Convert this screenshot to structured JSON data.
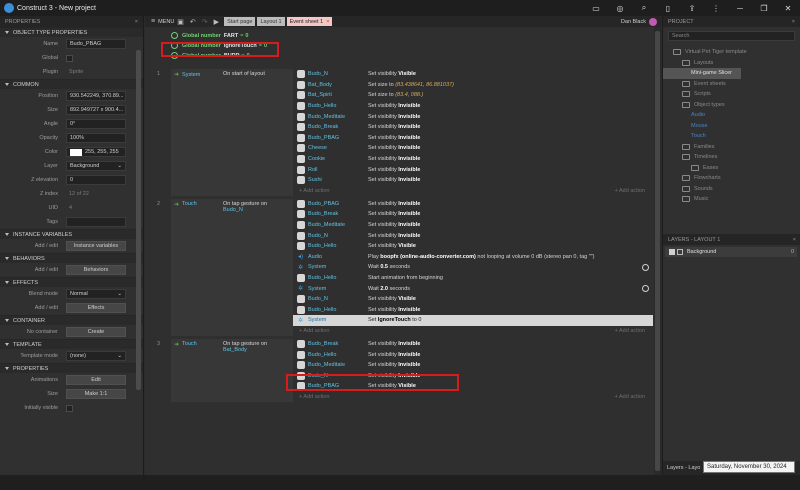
{
  "window": {
    "title": "Construct 3 - New project"
  },
  "left_panel": {
    "header": "PROPERTIES",
    "sections": [
      {
        "title": "OBJECT TYPE PROPERTIES",
        "rows": [
          {
            "label": "Name",
            "value": "Budo_PBAG",
            "kind": "input"
          },
          {
            "label": "Global",
            "value": "",
            "kind": "check"
          },
          {
            "label": "Plugin",
            "value": "Sprite",
            "kind": "plain"
          }
        ]
      },
      {
        "title": "COMMON",
        "rows": [
          {
            "label": "Position",
            "value": "930.542249, 370.89...",
            "kind": "input"
          },
          {
            "label": "Size",
            "value": "892.949727 x 900.4...",
            "kind": "input"
          },
          {
            "label": "Angle",
            "value": "0°",
            "kind": "input"
          },
          {
            "label": "Opacity",
            "value": "100%",
            "kind": "input"
          },
          {
            "label": "Color",
            "value": "255, 255, 255",
            "kind": "color"
          },
          {
            "label": "Layer",
            "value": "Background",
            "kind": "select"
          },
          {
            "label": "Z elevation",
            "value": "0",
            "kind": "input"
          },
          {
            "label": "Z index",
            "value": "12 of 22",
            "kind": "plain"
          },
          {
            "label": "UID",
            "value": "4",
            "kind": "plain"
          },
          {
            "label": "Tags",
            "value": "",
            "kind": "input"
          }
        ]
      },
      {
        "title": "INSTANCE VARIABLES",
        "rows": [
          {
            "label": "Add / edit",
            "value": "Instance variables",
            "kind": "button"
          }
        ]
      },
      {
        "title": "BEHAVIORS",
        "rows": [
          {
            "label": "Add / edit",
            "value": "Behaviors",
            "kind": "button"
          }
        ]
      },
      {
        "title": "EFFECTS",
        "rows": [
          {
            "label": "Blend mode",
            "value": "Normal",
            "kind": "select"
          },
          {
            "label": "Add / edit",
            "value": "Effects",
            "kind": "button"
          }
        ]
      },
      {
        "title": "CONTAINER",
        "rows": [
          {
            "label": "No container",
            "value": "Create",
            "kind": "button"
          }
        ]
      },
      {
        "title": "TEMPLATE",
        "rows": [
          {
            "label": "Template mode",
            "value": "(none)",
            "kind": "select"
          }
        ]
      },
      {
        "title": "PROPERTIES",
        "rows": [
          {
            "label": "Animations",
            "value": "Edit",
            "kind": "button"
          },
          {
            "label": "Size",
            "value": "Make 1:1",
            "kind": "button"
          },
          {
            "label": "Initially visible",
            "value": "",
            "kind": "check"
          }
        ]
      }
    ]
  },
  "menubar": {
    "menu_label": "MENU",
    "tabs": [
      "Start page",
      "Layout 1",
      "Event sheet 1"
    ],
    "tab_close": "×",
    "user": "Dan Black"
  },
  "event_sheet": {
    "globals": [
      {
        "keyword": "Global number",
        "name": "FART",
        "value": "0"
      },
      {
        "keyword": "Global number",
        "name": "IgnoreTouch",
        "value": "0"
      },
      {
        "keyword": "Global number",
        "name": "BURP",
        "value": "0"
      }
    ],
    "eq_sign": "=",
    "add_action": "+ Add action",
    "events": [
      {
        "number": "1",
        "cond_object": "System",
        "cond_text": "On start of layout",
        "actions": [
          {
            "object": "Budo_N",
            "pre": "Set visibility ",
            "bold": "Visible",
            "post": "",
            "icon": "sprite"
          },
          {
            "object": "Bat_Body",
            "pre": "Set size to ",
            "bold": "",
            "post": "(83.438641, 86.881037)",
            "icon": "sprite"
          },
          {
            "object": "Bat_Spirit",
            "pre": "Set size to ",
            "bold": "",
            "post": "(83.4, 088.)",
            "icon": "sprite"
          },
          {
            "object": "Budo_Hello",
            "pre": "Set visibility ",
            "bold": "Invisible",
            "post": "",
            "icon": "sprite"
          },
          {
            "object": "Budo_Meditate",
            "pre": "Set visibility ",
            "bold": "Invisible",
            "post": "",
            "icon": "sprite"
          },
          {
            "object": "Budo_Break",
            "pre": "Set visibility ",
            "bold": "Invisible",
            "post": "",
            "icon": "sprite"
          },
          {
            "object": "Budo_PBAG",
            "pre": "Set visibility ",
            "bold": "Invisible",
            "post": "",
            "icon": "sprite"
          },
          {
            "object": "Cheese",
            "pre": "Set visibility ",
            "bold": "Invisible",
            "post": "",
            "icon": "sprite"
          },
          {
            "object": "Cookie",
            "pre": "Set visibility ",
            "bold": "Invisible",
            "post": "",
            "icon": "sprite"
          },
          {
            "object": "Roll",
            "pre": "Set visibility ",
            "bold": "Invisible",
            "post": "",
            "icon": "sprite"
          },
          {
            "object": "Sushi",
            "pre": "Set visibility ",
            "bold": "Invisible",
            "post": "",
            "icon": "sprite"
          }
        ]
      },
      {
        "number": "2",
        "cond_object": "Touch",
        "cond_text": "On tap gesture on",
        "cond_target": "Budo_N",
        "actions": [
          {
            "object": "Budo_PBAG",
            "pre": "Set visibility ",
            "bold": "Invisible",
            "post": "",
            "icon": "sprite"
          },
          {
            "object": "Budo_Break",
            "pre": "Set visibility ",
            "bold": "Invisible",
            "post": "",
            "icon": "sprite"
          },
          {
            "object": "Budo_Meditate",
            "pre": "Set visibility ",
            "bold": "Invisible",
            "post": "",
            "icon": "sprite"
          },
          {
            "object": "Budo_N",
            "pre": "Set visibility ",
            "bold": "Invisible",
            "post": "",
            "icon": "sprite"
          },
          {
            "object": "Budo_Hello",
            "pre": "Set visibility ",
            "bold": "Visible",
            "post": "",
            "icon": "sprite"
          },
          {
            "object": "Audio",
            "pre": "Play ",
            "bold": "boopfx (online-audio-converter.com)",
            "post": " not looping at volume 0 dB (stereo pan 0, tag \"\")",
            "icon": "audio"
          },
          {
            "object": "System",
            "pre": "Wait ",
            "bold": "0.5",
            "post": " seconds",
            "icon": "gear",
            "wait": true
          },
          {
            "object": "Budo_Hello",
            "pre": "Start animation from beginning",
            "bold": "",
            "post": "",
            "icon": "sprite"
          },
          {
            "object": "System",
            "pre": "Wait ",
            "bold": "2.0",
            "post": " seconds",
            "icon": "gear",
            "wait": true
          },
          {
            "object": "Budo_N",
            "pre": "Set visibility ",
            "bold": "Visible",
            "post": "",
            "icon": "sprite"
          },
          {
            "object": "Budo_Hello",
            "pre": "Set visibility ",
            "bold": "Invisible",
            "post": "",
            "icon": "sprite"
          },
          {
            "object": "System",
            "pre": "Set ",
            "bold": "IgnoreTouch",
            "post": " to 0",
            "icon": "gear",
            "selected": true
          }
        ]
      },
      {
        "number": "3",
        "cond_object": "Touch",
        "cond_text": "On tap gesture on",
        "cond_target": "Bat_Body",
        "actions": [
          {
            "object": "Budo_Break",
            "pre": "Set visibility ",
            "bold": "Invisible",
            "post": "",
            "icon": "sprite"
          },
          {
            "object": "Budo_Hello",
            "pre": "Set visibility ",
            "bold": "Invisible",
            "post": "",
            "icon": "sprite"
          },
          {
            "object": "Budo_Meditate",
            "pre": "Set visibility ",
            "bold": "Invisible",
            "post": "",
            "icon": "sprite"
          },
          {
            "object": "Budo_N",
            "pre": "Set visibility ",
            "bold": "Invisible",
            "post": "",
            "icon": "sprite"
          },
          {
            "object": "Budo_PBAG",
            "pre": "Set visibility ",
            "bold": "Visible",
            "post": "",
            "icon": "sprite"
          }
        ]
      }
    ]
  },
  "project_panel": {
    "header": "PROJECT",
    "search_placeholder": "Search",
    "tree": [
      {
        "label": "Virtual Pet Tiger template",
        "depth": 0,
        "folder": true
      },
      {
        "label": "Layouts",
        "depth": 1,
        "folder": true
      },
      {
        "label": "Mini-game Slicer",
        "depth": 2,
        "folder": false,
        "highlight": true
      },
      {
        "label": "Event sheets",
        "depth": 1,
        "folder": true
      },
      {
        "label": "Scripts",
        "depth": 1,
        "folder": true
      },
      {
        "label": "Object types",
        "depth": 1,
        "folder": true
      },
      {
        "label": "Audio",
        "depth": 2,
        "folder": false,
        "blue": true
      },
      {
        "label": "Mouse",
        "depth": 2,
        "folder": false,
        "blue": true
      },
      {
        "label": "Touch",
        "depth": 2,
        "folder": false,
        "blue": true
      },
      {
        "label": "Families",
        "depth": 1,
        "folder": true
      },
      {
        "label": "Timelines",
        "depth": 1,
        "folder": true
      },
      {
        "label": "Eases",
        "depth": 2,
        "folder": true
      },
      {
        "label": "Flowcharts",
        "depth": 1,
        "folder": true
      },
      {
        "label": "Sounds",
        "depth": 1,
        "folder": true
      },
      {
        "label": "Music",
        "depth": 1,
        "folder": true
      }
    ]
  },
  "layers_panel": {
    "header": "LAYERS - LAYOUT 1",
    "layer": "Background",
    "count": "0",
    "bottom_tabs": "Layers - Layo"
  },
  "tooltip": "Saturday, November 30, 2024"
}
